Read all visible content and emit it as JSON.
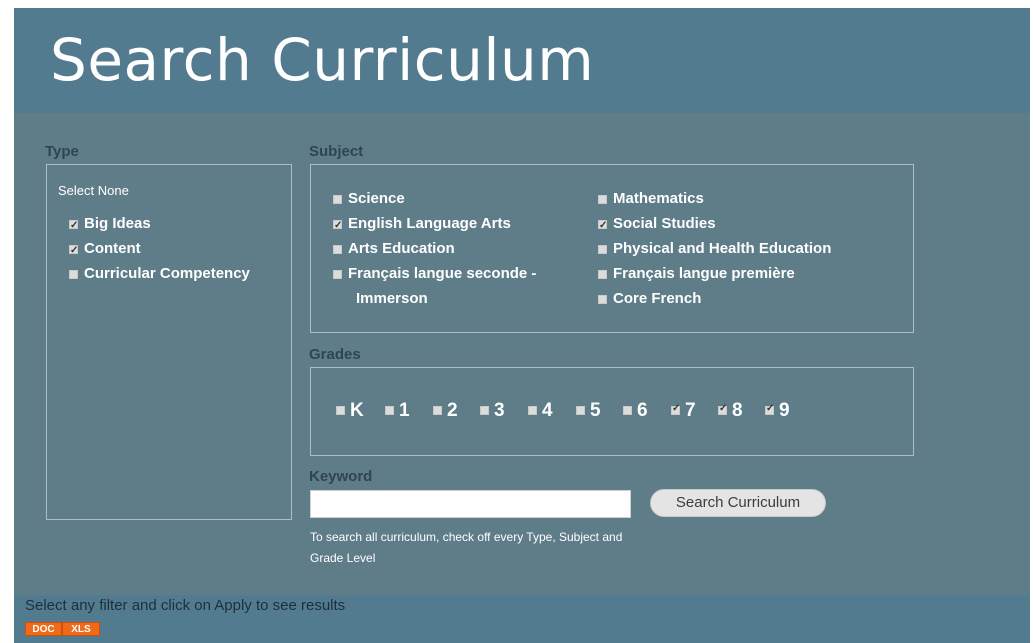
{
  "page": {
    "title": "Search Curriculum"
  },
  "type": {
    "label": "Type",
    "select_none": "Select None",
    "options": [
      {
        "label": "Big Ideas",
        "checked": true
      },
      {
        "label": "Content",
        "checked": true
      },
      {
        "label": "Curricular Competency",
        "checked": false
      }
    ]
  },
  "subject": {
    "label": "Subject",
    "left": [
      {
        "label": "Science",
        "checked": false
      },
      {
        "label": "English Language Arts",
        "checked": true
      },
      {
        "label": "Arts Education",
        "checked": false
      },
      {
        "label": "Français langue seconde -",
        "label_line2": "Immerson",
        "checked": false
      }
    ],
    "right": [
      {
        "label": "Mathematics",
        "checked": false
      },
      {
        "label": "Social Studies",
        "checked": true
      },
      {
        "label": "Physical and Health Education",
        "checked": false
      },
      {
        "label": "Français langue première",
        "checked": false
      },
      {
        "label": "Core French",
        "checked": false
      }
    ]
  },
  "grades": {
    "label": "Grades",
    "items": [
      {
        "label": "K",
        "checked": false
      },
      {
        "label": "1",
        "checked": false
      },
      {
        "label": "2",
        "checked": false
      },
      {
        "label": "3",
        "checked": false
      },
      {
        "label": "4",
        "checked": false
      },
      {
        "label": "5",
        "checked": false
      },
      {
        "label": "6",
        "checked": false
      },
      {
        "label": "7",
        "checked": true
      },
      {
        "label": "8",
        "checked": true
      },
      {
        "label": "9",
        "checked": true
      }
    ]
  },
  "keyword": {
    "label": "Keyword",
    "value": "",
    "button_label": "Search Curriculum",
    "hint": "To search all curriculum, check off every Type, Subject and Grade Level"
  },
  "results": {
    "message": "Select any filter and click on Apply to see results",
    "export_doc": "DOC",
    "export_xls": "XLS"
  },
  "colors": {
    "background": "#537b90",
    "panel": "#5f7d89",
    "export_button": "#f06a1a"
  }
}
